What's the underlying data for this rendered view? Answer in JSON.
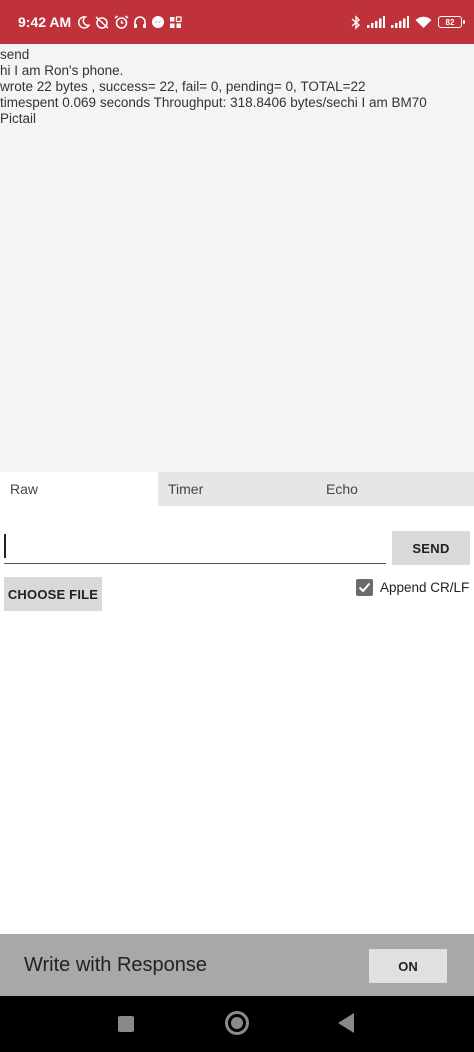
{
  "status_bar": {
    "time": "9:42 AM",
    "battery": "82",
    "left_icons": [
      "moon-icon",
      "alarm-off-icon",
      "alarm-icon",
      "headphones-icon",
      "messenger-icon",
      "apps-icon"
    ],
    "right_icons": [
      "bluetooth-icon",
      "signal-icon",
      "signal-icon",
      "wifi-icon",
      "battery-icon"
    ],
    "color": "#c0323a"
  },
  "log": {
    "lines": [
      "send",
      "hi I am Ron's phone.",
      "wrote 22 bytes , success= 22, fail= 0, pending= 0, TOTAL=22",
      "timespent 0.069 seconds  Throughput: 318.8406 bytes/sechi I am BM70",
      "Pictail"
    ]
  },
  "tabs": [
    {
      "label": "Raw",
      "active": true
    },
    {
      "label": "Timer",
      "active": false
    },
    {
      "label": "Echo",
      "active": false
    }
  ],
  "input": {
    "value": "",
    "send_label": "SEND"
  },
  "file": {
    "choose_label": "CHOOSE FILE"
  },
  "append": {
    "label": "Append CR/LF",
    "checked": true
  },
  "write_bar": {
    "label": "Write with Response",
    "toggle_label": "ON"
  }
}
